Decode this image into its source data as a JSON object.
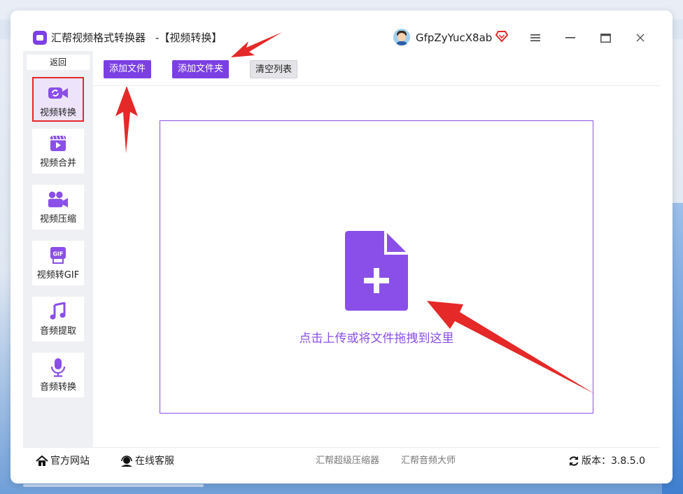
{
  "app": {
    "title": "汇帮视频格式转换器",
    "subtitle": "-【视频转换】",
    "username": "GfpZyYucX8ab"
  },
  "sidebar": {
    "back_label": "返回",
    "items": [
      {
        "label": "视频转换",
        "icon": "video-convert-icon",
        "active": true
      },
      {
        "label": "视频合并",
        "icon": "video-merge-icon"
      },
      {
        "label": "视频压缩",
        "icon": "video-compress-icon"
      },
      {
        "label": "视频转GIF",
        "icon": "gif-icon"
      },
      {
        "label": "音频提取",
        "icon": "music-note-icon"
      },
      {
        "label": "音频转换",
        "icon": "microphone-icon"
      }
    ]
  },
  "toolbar": {
    "add_file": "添加文件",
    "add_folder": "添加文件夹",
    "clear_list": "清空列表"
  },
  "dropzone": {
    "text": "点击上传或将文件拖拽到这里"
  },
  "footer": {
    "official_site": "官方网站",
    "online_service": "在线客服",
    "link1": "汇帮超级压缩器",
    "link2": "汇帮音频大师",
    "version": "版本：3.8.5.0"
  },
  "colors": {
    "accent": "#7b3fe4",
    "annotation": "#e52828"
  }
}
